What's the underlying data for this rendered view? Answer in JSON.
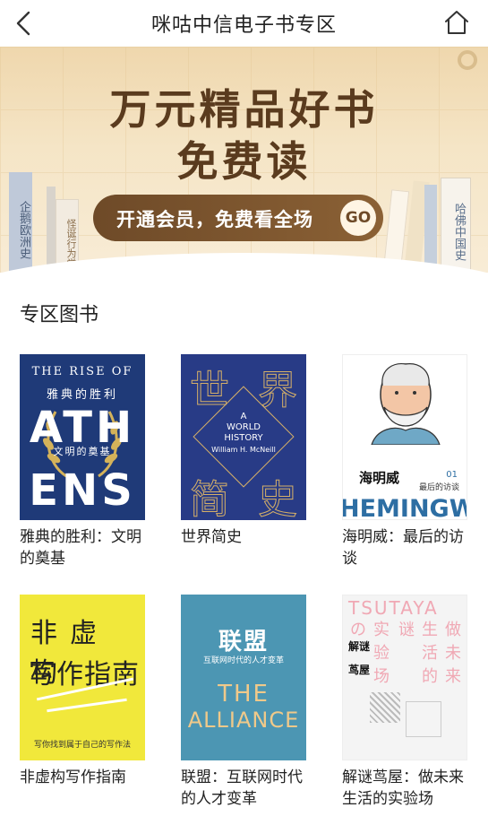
{
  "header": {
    "title": "咪咕中信电子书专区",
    "back_icon": "chevron-left-icon",
    "home_icon": "home-icon"
  },
  "banner": {
    "headline": "万元精品好书",
    "subline": "免费读",
    "cta_label": "开通会员，免费看全场",
    "cta_go": "GO",
    "spine_left_1": "企鹅欧洲史",
    "spine_left_2": "怪诞行为学",
    "spine_right": "哈佛中国史"
  },
  "section": {
    "title": "专区图书"
  },
  "books": [
    {
      "title": "雅典的胜利：文明的奠基",
      "cover": {
        "line1": "THE RISE OF",
        "line2": "雅典的胜利",
        "line3": "ATH",
        "line4": "ENS",
        "line5": "文明的奠基"
      }
    },
    {
      "title": "世界简史",
      "cover": {
        "cn1": "世",
        "cn2": "界",
        "cn3": "简",
        "cn4": "史",
        "en1": "A",
        "en2": "WORLD",
        "en3": "HISTORY",
        "author": "William H. McNeill"
      }
    },
    {
      "title": "海明威：最后的访谈",
      "cover": {
        "cn": "海明威",
        "num": "01",
        "sub": "最后的访谈",
        "en": "HEMINGW"
      }
    },
    {
      "title": "非虚构写作指南",
      "cover": {
        "line1": "非虚构",
        "line2": "写作指南",
        "foot": "写你找到属于自己的写作法"
      }
    },
    {
      "title": "联盟：互联网时代的人才变革",
      "cover": {
        "cn": "联盟",
        "sub": "互联网时代的人才变革",
        "en1": "THE",
        "en2": "ALLIANCE"
      }
    },
    {
      "title": "解谜茑屋：做未来生活的实验场",
      "cover": {
        "top": "TSUTAYA",
        "c1": "の",
        "c2": "实",
        "c3": "谜",
        "c4": "生",
        "c5": "做",
        "c6": "验",
        "c7": "活",
        "c8": "未",
        "c9": "场",
        "c10": "的",
        "c11": "来",
        "t1": "解谜",
        "t2": "茑屋"
      }
    }
  ]
}
